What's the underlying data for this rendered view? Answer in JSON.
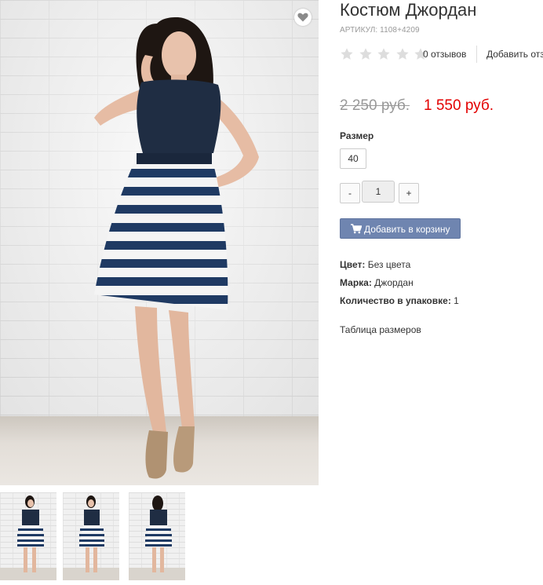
{
  "product": {
    "title": "Костюм Джордан",
    "sku": "АРТИКУЛ: 1108+4209",
    "rating_stars": 0,
    "rating_max": 5,
    "reviews_label": "0 отзывов",
    "add_review_label": "Добавить отзыв",
    "old_price": "2 250 руб.",
    "new_price": "1 550 руб.",
    "size_label": "Размер",
    "sizes": [
      "40"
    ],
    "quantity": "1",
    "qty_minus": "-",
    "qty_plus": "+",
    "add_to_cart_label": "Добавить в корзину",
    "attributes": [
      {
        "label": "Цвет:",
        "value": "Без цвета"
      },
      {
        "label": "Марка:",
        "value": "Джордан"
      },
      {
        "label": "Количество в упаковке:",
        "value": "1"
      }
    ],
    "size_table_label": "Таблица размеров"
  },
  "colors": {
    "accent_button": "#6f85b0",
    "sale_price": "#e30000",
    "old_price": "#999999",
    "star_empty": "#dddddd"
  },
  "icons": {
    "favorite": "heart-icon",
    "cart": "cart-icon",
    "star": "star-icon"
  }
}
